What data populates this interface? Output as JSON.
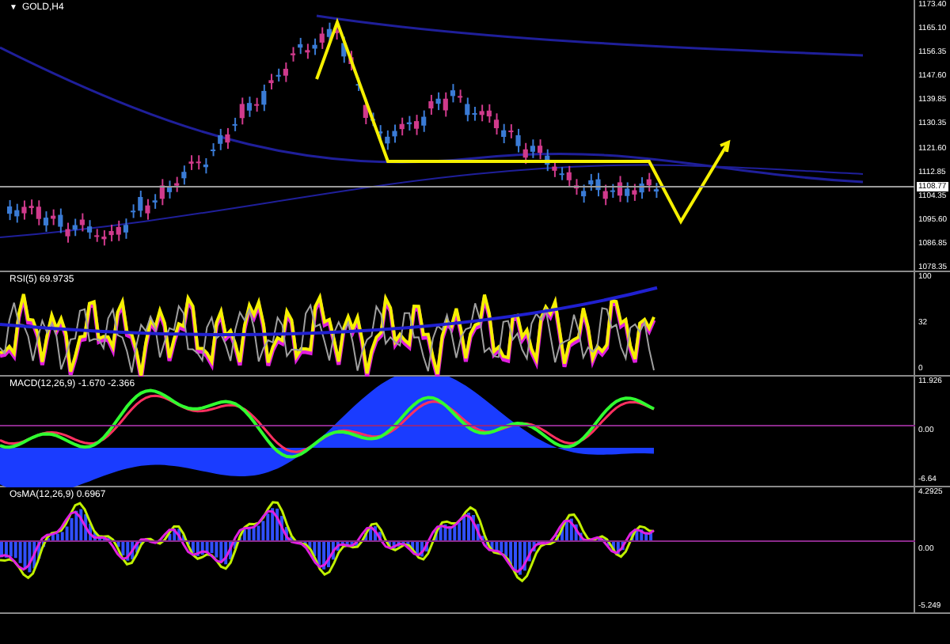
{
  "panes": [
    {
      "kind": "price",
      "menu_arrow": "▼",
      "title": "GOLD,H4",
      "axis_labels": [
        "1173.40",
        "1165.10",
        "1156.35",
        "1147.60",
        "1139.85",
        "1130.35",
        "1121.60",
        "1112.85",
        "1104.35",
        "1095.60",
        "1086.85",
        "1078.35"
      ],
      "current_price": "1108.77"
    },
    {
      "kind": "rsi",
      "title": "RSI(5) 69.9735",
      "axis_labels": [
        "100",
        "32",
        "0"
      ]
    },
    {
      "kind": "macd",
      "title": "MACD(12,26,9) -1.670 -2.366",
      "axis_labels": [
        "11.926",
        "0.00",
        "-6.64"
      ]
    },
    {
      "kind": "osma",
      "title": "OsMA(12,26,9) 0.6967",
      "axis_labels": [
        "4.2925",
        "0.00",
        "-5.249"
      ]
    }
  ]
}
